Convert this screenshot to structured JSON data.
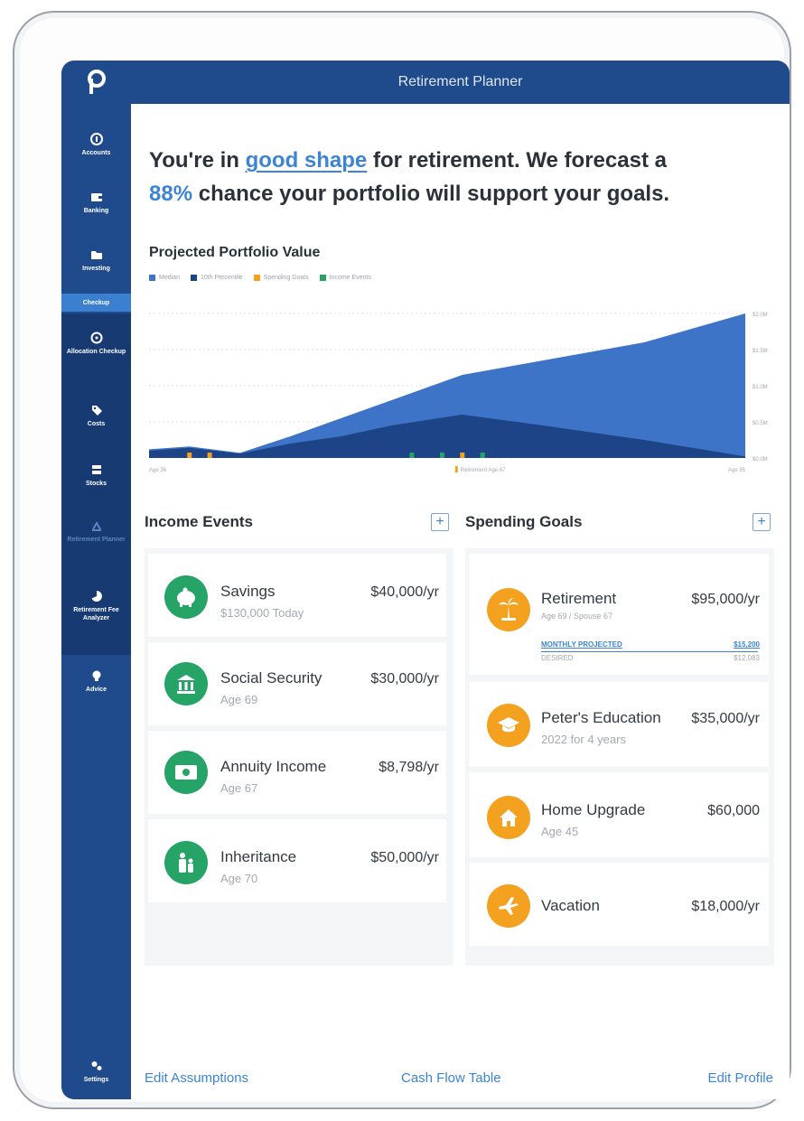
{
  "app": {
    "title": "Retirement Planner",
    "logo_letter": "P"
  },
  "sidebar": {
    "items": [
      {
        "label": "Accounts",
        "icon": "dollar-circle-icon"
      },
      {
        "label": "Banking",
        "icon": "wallet-icon"
      },
      {
        "label": "Investing",
        "icon": "folder-icon"
      },
      {
        "label": "Checkup",
        "icon": ""
      },
      {
        "label": "Allocation Checkup",
        "icon": "clock-icon"
      },
      {
        "label": "Costs",
        "icon": "tag-icon"
      },
      {
        "label": "Stocks",
        "icon": "box-icon"
      },
      {
        "label": "Retirement Planner",
        "icon": "beach-chair-icon"
      },
      {
        "label": "Retirement Fee Analyzer",
        "icon": "pie-icon"
      },
      {
        "label": "Advice",
        "icon": "lightbulb-icon"
      },
      {
        "label": "Settings",
        "icon": "gears-icon"
      }
    ]
  },
  "headline": {
    "part1": "You're in ",
    "highlight1": "good shape",
    "part2": " for retirement. We forecast a",
    "highlight2": "88%",
    "part3": " chance your portfolio will support your goals."
  },
  "chart_data": {
    "type": "area",
    "title": "Projected Portfolio Value",
    "legend": [
      "Median",
      "10th Percentile",
      "Spending Goals",
      "Income Events"
    ],
    "x_labels": {
      "start": "Age 36",
      "marker": "Retirement Age 67",
      "end": "Age 95"
    },
    "y_ticks": [
      "$2.0M",
      "$1.5M",
      "$1.0M",
      "$0.5M",
      "$0.0M"
    ],
    "ylim": [
      0,
      2.0
    ],
    "x": [
      36,
      40,
      45,
      50,
      55,
      60,
      67,
      75,
      85,
      95
    ],
    "series": [
      {
        "name": "Median",
        "values": [
          0.12,
          0.16,
          0.07,
          0.3,
          0.55,
          0.8,
          1.15,
          1.35,
          1.6,
          2.0
        ]
      },
      {
        "name": "10th Percentile",
        "values": [
          0.1,
          0.14,
          0.06,
          0.2,
          0.3,
          0.45,
          0.6,
          0.45,
          0.25,
          0.02
        ]
      }
    ],
    "spending_goal_ages": [
      40,
      42,
      67
    ],
    "income_event_ages": [
      62,
      65,
      69
    ],
    "colors": {
      "median": "#3d74c7",
      "p10": "#1d4486",
      "spending": "#f3a11f",
      "income": "#26a467"
    }
  },
  "income_events": {
    "title": "Income Events",
    "add_label": "+",
    "items": [
      {
        "name": "Savings",
        "sub": "$130,000 Today",
        "amount": "$40,000/yr",
        "icon": "piggy-bank-icon"
      },
      {
        "name": "Social Security",
        "sub": "Age 69",
        "amount": "$30,000/yr",
        "icon": "bank-icon"
      },
      {
        "name": "Annuity Income",
        "sub": "Age 67",
        "amount": "$8,798/yr",
        "icon": "cash-icon"
      },
      {
        "name": "Inheritance",
        "sub": "Age 70",
        "amount": "$50,000/yr",
        "icon": "family-icon"
      }
    ]
  },
  "spending_goals": {
    "title": "Spending Goals",
    "add_label": "+",
    "items": [
      {
        "name": "Retirement",
        "sub": "Age 69 / Spouse 67",
        "amount": "$95,000/yr",
        "icon": "palm-tree-icon"
      },
      {
        "name": "Peter's Education",
        "sub": "2022 for 4 years",
        "amount": "$35,000/yr",
        "icon": "graduation-cap-icon"
      },
      {
        "name": "Home Upgrade",
        "sub": "Age 45",
        "amount": "$60,000",
        "icon": "house-icon"
      },
      {
        "name": "Vacation",
        "sub": "",
        "amount": "$18,000/yr",
        "icon": "airplane-icon"
      }
    ],
    "retirement_detail": {
      "projected_label": "MONTHLY PROJECTED",
      "projected_value": "$15,200",
      "desired_label": "DESIRED",
      "desired_value": "$12,083"
    }
  },
  "footer": {
    "edit_assumptions": "Edit Assumptions",
    "cash_flow": "Cash Flow Table",
    "edit_profile": "Edit Profile"
  }
}
